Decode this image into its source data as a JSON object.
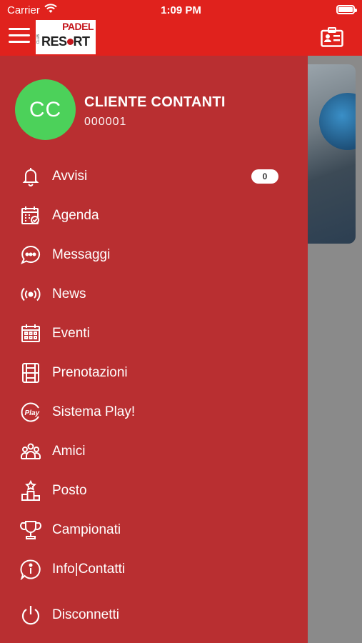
{
  "status_bar": {
    "carrier": "Carrier",
    "time": "1:09 PM",
    "battery_level": 1.0
  },
  "header": {
    "logo": {
      "line1": "PADEL",
      "line2_a": "RES",
      "line2_b": "RT",
      "side_text": "CLUB"
    }
  },
  "user": {
    "initials": "CC",
    "name": "CLIENTE CONTANTI",
    "code": "000001",
    "avatar_color": "#4cd15a"
  },
  "menu": [
    {
      "label": "Avvisi",
      "icon": "bell-icon",
      "counter": "0"
    },
    {
      "label": "Agenda",
      "icon": "calendar-check-icon"
    },
    {
      "label": "Messaggi",
      "icon": "chat-bubble-icon"
    },
    {
      "label": "News",
      "icon": "broadcast-icon"
    },
    {
      "label": "Eventi",
      "icon": "calendar-grid-icon"
    },
    {
      "label": "Prenotazioni",
      "icon": "court-icon"
    },
    {
      "label": "Sistema Play!",
      "icon": "play-badge-icon"
    },
    {
      "label": "Amici",
      "icon": "group-icon"
    },
    {
      "label": "Posto",
      "icon": "podium-icon"
    },
    {
      "label": "Campionati",
      "icon": "trophy-icon"
    },
    {
      "label": "Info|Contatti",
      "icon": "info-icon"
    },
    {
      "label": "Disconnetti",
      "icon": "power-icon"
    }
  ],
  "colors": {
    "brand_red": "#e0221d",
    "drawer_red": "#b92f31",
    "avatar_green": "#4cd15a"
  }
}
